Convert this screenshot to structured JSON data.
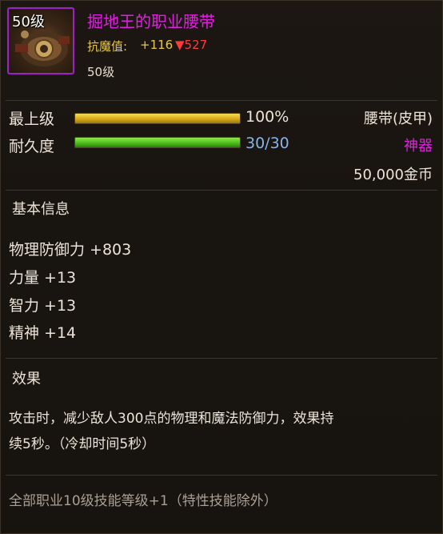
{
  "item": {
    "icon_level": "50级",
    "name": "掘地王的职业腰带",
    "resist_label": "抗魔值:",
    "resist_value": "+116",
    "resist_down": "▼527",
    "required_level": "50级"
  },
  "stats": {
    "upgrade_label": "最上级",
    "upgrade_percent": "100%",
    "upgrade_fraction": 1.0,
    "durability_label": "耐久度",
    "durability_text": "30/30",
    "durability_fraction": 1.0,
    "type": "腰带(皮甲)",
    "rarity": "神器",
    "price": "50,000金币"
  },
  "basic": {
    "title": "基本信息",
    "attributes": [
      "物理防御力 +803",
      "力量 +13",
      "智力 +13",
      "精神 +14"
    ]
  },
  "effect": {
    "title": "效果",
    "line1": "攻击时，减少敌人300点的物理和魔法防御力，效果持",
    "line2": "续5秒。（冷却时间5秒）"
  },
  "passive": "全部职业10级技能等级+1（特性技能除外）",
  "colors": {
    "legendary": "#e020e0",
    "gold": "#e8c84a",
    "down": "#ff3a3a",
    "durability_text": "#8ab4e8"
  }
}
